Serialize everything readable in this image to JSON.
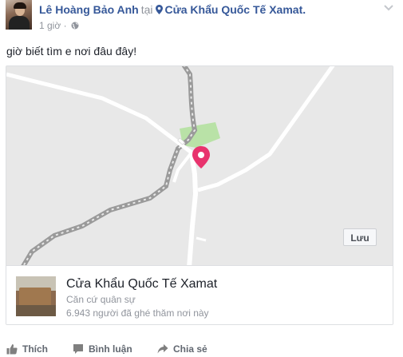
{
  "post": {
    "author": "Lê Hoàng Bảo Anh",
    "at_word": "tại",
    "place_name": "Cửa Khẩu Quốc Tế Xamat.",
    "time": "1 giờ",
    "separator": "·",
    "text": "giờ biết tìm e nơi đâu đây!"
  },
  "place_card": {
    "name": "Cửa Khẩu Quốc Tế Xamat",
    "category": "Căn cứ quân sự",
    "visits": "6.943 người đã ghé thăm nơi này",
    "save_label": "Lưu"
  },
  "actions": {
    "like": "Thích",
    "comment": "Bình luận",
    "share": "Chia sẻ"
  },
  "colors": {
    "link": "#365899",
    "muted": "#90949c",
    "pin": "#e8336d",
    "map_bg": "#e8e8e8",
    "park": "#b9e2a7"
  },
  "icons": [
    "avatar",
    "location-pin-icon",
    "chevron-down-icon",
    "globe-icon",
    "map-pin-icon",
    "like-icon",
    "comment-icon",
    "share-icon"
  ]
}
